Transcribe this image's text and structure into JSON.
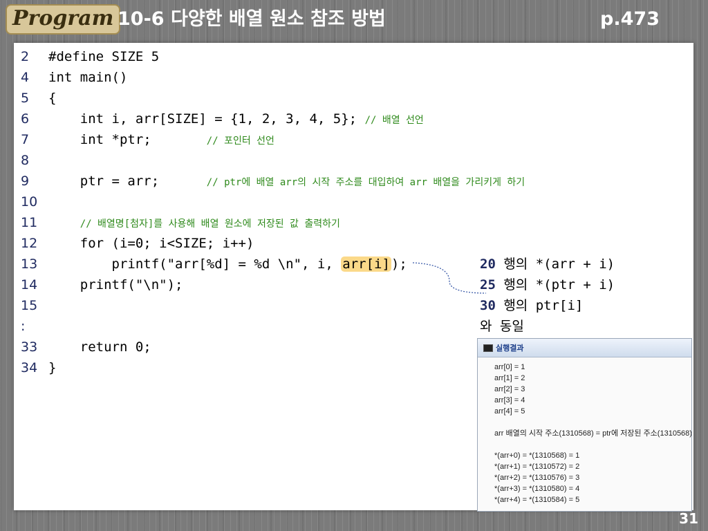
{
  "header": {
    "logo": "Program",
    "title_number": "10-6",
    "title_text": "다양한 배열 원소 참조 방법",
    "page_ref": "p.473"
  },
  "code_lines": [
    {
      "n": "2",
      "code": "#define SIZE 5",
      "comment": ""
    },
    {
      "n": "4",
      "code": "int main()",
      "comment": ""
    },
    {
      "n": "5",
      "code": "{",
      "comment": ""
    },
    {
      "n": "6",
      "code": "    int i, arr[SIZE] = {1, 2, 3, 4, 5}; ",
      "comment": "// 배열 선언"
    },
    {
      "n": "7",
      "code": "    int *ptr;       ",
      "comment": "// 포인터 선언"
    },
    {
      "n": "8",
      "code": "",
      "comment": ""
    },
    {
      "n": "9",
      "code": "    ptr = arr;      ",
      "comment": "// ptr에 배열 arr의 시작 주소를 대입하여 arr 배열을 가리키게 하기"
    },
    {
      "n": "10",
      "code": "",
      "comment": ""
    },
    {
      "n": "11",
      "code": "    ",
      "comment": "// 배열명[첨자]를 사용해 배열 원소에 저장된 값 출력하기"
    },
    {
      "n": "12",
      "code": "    for (i=0; i<SIZE; i++)",
      "comment": ""
    },
    {
      "n": "13",
      "code_pre": "        printf(\"arr[%d] = %d \\n\", i, ",
      "code_hl": "arr[i]",
      "code_post": ");"
    },
    {
      "n": "14",
      "code": "    printf(\"\\n\");",
      "comment": ""
    },
    {
      "n": "15",
      "code": "",
      "comment": ""
    },
    {
      "n": ":",
      "code": "",
      "comment": ""
    },
    {
      "n": "33",
      "code": "    return 0;",
      "comment": ""
    },
    {
      "n": "34",
      "code": "}",
      "comment": ""
    }
  ],
  "note": {
    "rows": [
      {
        "n": "20",
        "text": " 행의 *(arr + i)"
      },
      {
        "n": "25",
        "text": " 행의 *(ptr + i)"
      },
      {
        "n": "30",
        "text": " 행의 ptr[i]"
      }
    ],
    "tail": "와 동일"
  },
  "result_window": {
    "title": "실행결과",
    "lines": [
      "arr[0] = 1",
      "arr[1] = 2",
      "arr[2] = 3",
      "arr[3] = 4",
      "arr[4] = 5",
      "",
      "arr 배열의 시작 주소(1310568) = ptr에 저장된 주소(1310568)",
      "",
      "*(arr+0) = *(1310568) = 1",
      "*(arr+1) = *(1310572) = 2",
      "*(arr+2) = *(1310576) = 3",
      "*(arr+3) = *(1310580) = 4",
      "*(arr+4) = *(1310584) = 5"
    ]
  },
  "page_number": "31",
  "colors": {
    "comment": "#2f8a1c",
    "line_number": "#1f2a60",
    "highlight": "#fbd989",
    "background": "#7b7b7b"
  }
}
